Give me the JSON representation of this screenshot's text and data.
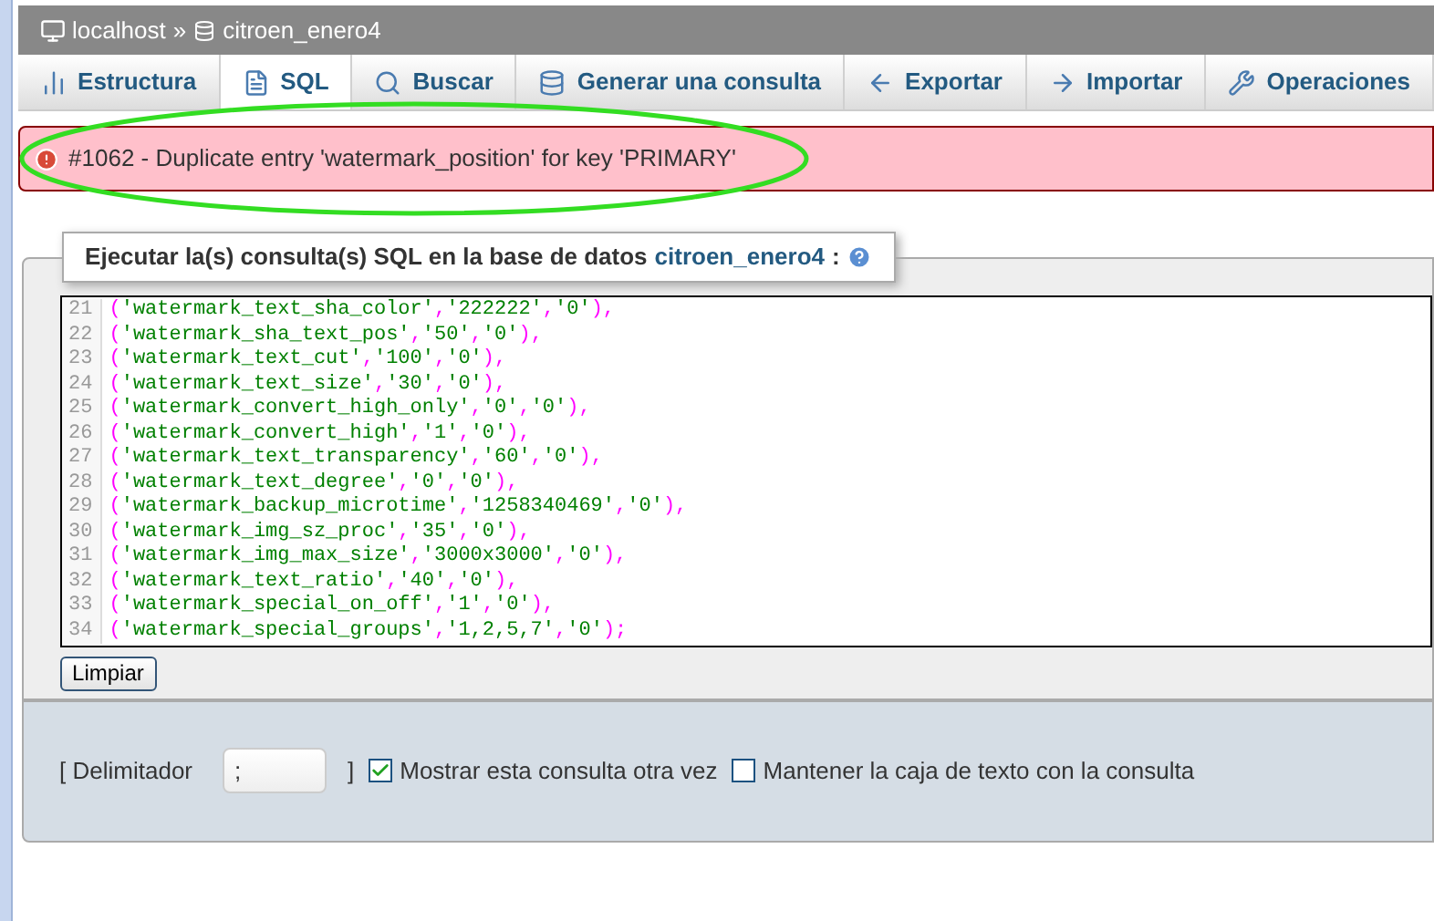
{
  "breadcrumb": {
    "server": "localhost",
    "separator": "»",
    "database": "citroen_enero4"
  },
  "tabs": [
    {
      "label": "Estructura",
      "kind": "structure",
      "selected": false
    },
    {
      "label": "SQL",
      "kind": "sql",
      "selected": true
    },
    {
      "label": "Buscar",
      "kind": "search",
      "selected": false
    },
    {
      "label": "Generar una consulta",
      "kind": "db",
      "selected": false
    },
    {
      "label": "Exportar",
      "kind": "export",
      "selected": false
    },
    {
      "label": "Importar",
      "kind": "import",
      "selected": false
    },
    {
      "label": "Operaciones",
      "kind": "wrench",
      "selected": false
    }
  ],
  "error": {
    "message": "#1062 - Duplicate entry 'watermark_position' for key 'PRIMARY'"
  },
  "query_panel": {
    "legend": "Ejecutar la(s) consulta(s) SQL en la base de datos",
    "database_link": "citroen_enero4",
    "legend_suffix": ":",
    "lines": [
      {
        "number": "21",
        "code": "('watermark_text_sha_color','222222','0'),"
      },
      {
        "number": "22",
        "code": "('watermark_sha_text_pos','50','0'),"
      },
      {
        "number": "23",
        "code": "('watermark_text_cut','100','0'),"
      },
      {
        "number": "24",
        "code": "('watermark_text_size','30','0'),"
      },
      {
        "number": "25",
        "code": "('watermark_convert_high_only','0','0'),"
      },
      {
        "number": "26",
        "code": "('watermark_convert_high','1','0'),"
      },
      {
        "number": "27",
        "code": "('watermark_text_transparency','60','0'),"
      },
      {
        "number": "28",
        "code": "('watermark_text_degree','0','0'),"
      },
      {
        "number": "29",
        "code": "('watermark_backup_microtime','1258340469','0'),"
      },
      {
        "number": "30",
        "code": "('watermark_img_sz_proc','35','0'),"
      },
      {
        "number": "31",
        "code": "('watermark_img_max_size','3000x3000','0'),"
      },
      {
        "number": "32",
        "code": "('watermark_text_ratio','40','0'),"
      },
      {
        "number": "33",
        "code": "('watermark_special_on_off','1','0'),"
      },
      {
        "number": "34",
        "code": "('watermark_special_groups','1,2,5,7','0');"
      }
    ],
    "clear_button": "Limpiar"
  },
  "options": {
    "delimiter_open": "[ Delimitador",
    "delimiter_value": ";",
    "delimiter_close": "]",
    "checkboxes": [
      {
        "label": "Mostrar esta consulta otra vez",
        "checked": true
      },
      {
        "label": "Mantener la caja de texto con la consulta",
        "checked": false
      }
    ]
  }
}
